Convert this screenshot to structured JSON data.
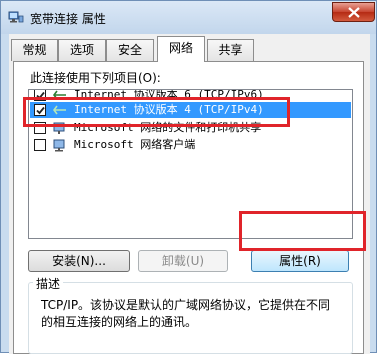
{
  "window": {
    "title": "宽带连接 属性"
  },
  "tabs": [
    {
      "label": "常规"
    },
    {
      "label": "选项"
    },
    {
      "label": "安全"
    },
    {
      "label": "网络"
    },
    {
      "label": "共享"
    }
  ],
  "active_tab": "网络",
  "panel": {
    "connection_uses_label": "此连接使用下列项目(O):",
    "items": [
      {
        "label": "Internet 协议版本 6 (TCP/IPv6)",
        "checked": true,
        "icon": "network-protocol-icon"
      },
      {
        "label": "Internet 协议版本 4 (TCP/IPv4)",
        "checked": true,
        "selected": true,
        "icon": "network-protocol-icon"
      },
      {
        "label": "Microsoft 网络的文件和打印机共享",
        "checked": false,
        "icon": "network-service-icon"
      },
      {
        "label": "Microsoft 网络客户端",
        "checked": false,
        "icon": "network-client-icon"
      }
    ],
    "buttons": {
      "install": "安装(N)...",
      "uninstall": "卸载(U)",
      "properties": "属性(R)"
    },
    "description": {
      "title": "描述",
      "text": "TCP/IP。该协议是默认的广域网络协议，它提供在不同\n的相互连接的网络上的通讯。"
    }
  },
  "colors": {
    "selection": "#3399ff",
    "highlight": "#e0242a",
    "close_button": "#c7442f"
  }
}
